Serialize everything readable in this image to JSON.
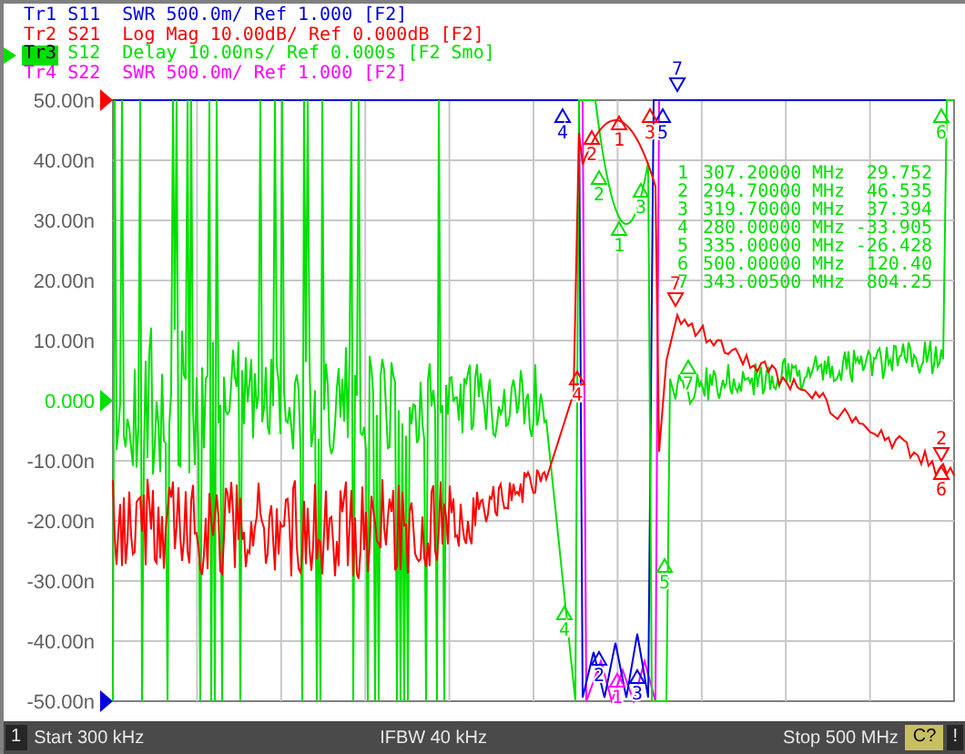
{
  "traces": [
    {
      "label": "Tr1",
      "param": "S11",
      "format": "SWR 500.0m/ Ref 1.000",
      "tag": "[F2]",
      "color": "#0000e0",
      "selected": false,
      "markers": [
        {
          "label": "4"
        },
        {
          "label": "5"
        },
        {
          "label": "7"
        },
        {
          "label": "2"
        },
        {
          "label": "3"
        }
      ]
    },
    {
      "label": "Tr2",
      "param": "S21",
      "format": "Log Mag 10.00dB/ Ref 0.000dB",
      "tag": "[F2]",
      "color": "#ff0000",
      "selected": false,
      "markers": [
        {
          "label": "2"
        },
        {
          "label": "1"
        },
        {
          "label": "3"
        },
        {
          "label": "4"
        },
        {
          "label": "7"
        },
        {
          "label": "2"
        },
        {
          "label": "6"
        }
      ]
    },
    {
      "label": "Tr3",
      "param": "S12",
      "format": "Delay 10.00ns/ Ref 0.000s",
      "tag": "[F2 Smo]",
      "color": "#00e000",
      "selected": true
    },
    {
      "label": "Tr4",
      "param": "S22",
      "format": "SWR 500.0m/ Ref 1.000",
      "tag": "[F2]",
      "color": "#ff00ff",
      "selected": false,
      "markers": [
        {
          "label": "1"
        }
      ]
    }
  ],
  "y_axis_labels": [
    {
      "text": "50.00n",
      "reference": false
    },
    {
      "text": "40.00n",
      "reference": false
    },
    {
      "text": "30.00n",
      "reference": false
    },
    {
      "text": "20.00n",
      "reference": false
    },
    {
      "text": "10.00n",
      "reference": false
    },
    {
      "text": "0.000",
      "reference": true
    },
    {
      "text": "-10.00n",
      "reference": false
    },
    {
      "text": "-20.00n",
      "reference": false
    },
    {
      "text": "-30.00n",
      "reference": false
    },
    {
      "text": "-40.00n",
      "reference": false
    },
    {
      "text": "-50.00n",
      "reference": false
    }
  ],
  "marker_table": [
    {
      "number": "1",
      "frequency": "307.20000",
      "unit": "MHz",
      "value": "29.752",
      "plot_label": "1"
    },
    {
      "number": "2",
      "frequency": "294.70000",
      "unit": "MHz",
      "value": "46.535",
      "plot_label": "2"
    },
    {
      "number": "3",
      "frequency": "319.70000",
      "unit": "MHz",
      "value": "37.394",
      "plot_label": "3"
    },
    {
      "number": "4",
      "frequency": "280.00000",
      "unit": "MHz",
      "value": "-33.905",
      "plot_label": "4"
    },
    {
      "number": "5",
      "frequency": "335.00000",
      "unit": "MHz",
      "value": "-26.428",
      "plot_label": "5"
    },
    {
      "number": "6",
      "frequency": "500.00000",
      "unit": "MHz",
      "value": "120.40",
      "plot_label": "6"
    },
    {
      "number": "7",
      "frequency": "343.00500",
      "unit": "MHz",
      "value": "804.25",
      "plot_label": "7"
    }
  ],
  "status_bar": {
    "channel": "1",
    "start": "Start 300 kHz",
    "ifbw": "IFBW 40 kHz",
    "stop": "Stop 500 MHz",
    "calibration": "C?",
    "alert": "!"
  }
}
